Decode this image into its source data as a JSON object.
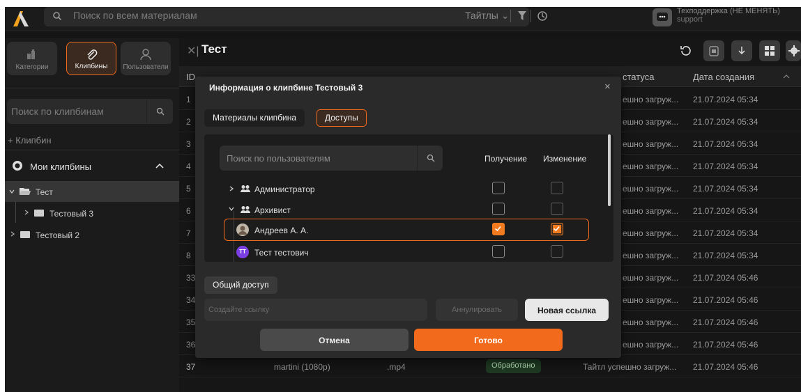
{
  "topbar": {
    "search_placeholder": "Поиск по всем материалам",
    "type_filter": "Тайтлы ⌄",
    "user_name": "Техподдержка (НЕ МЕНЯТЬ)",
    "user_role": "support"
  },
  "sidebar": {
    "tabs": [
      {
        "label": "Категории"
      },
      {
        "label": "Клипбины"
      },
      {
        "label": "Пользователи"
      }
    ],
    "search_placeholder": "Поиск по клипбинам",
    "add_label": "+ Клипбин",
    "my_clipbins": "Мои клипбины",
    "tree": [
      {
        "label": "Тест"
      },
      {
        "label": "Тестовый 3"
      },
      {
        "label": "Тестовый 2"
      }
    ]
  },
  "main": {
    "title": "Тест",
    "columns": {
      "id": "ID",
      "status": "статуса",
      "created": "Дата создания"
    },
    "rows": [
      {
        "id": "1",
        "status": "ешно загруж...",
        "date": "21.07.2024 05:34"
      },
      {
        "id": "2",
        "status": "ешно загруж...",
        "date": "21.07.2024 05:34"
      },
      {
        "id": "3",
        "status": "ешно загруж...",
        "date": "21.07.2024 05:34"
      },
      {
        "id": "4",
        "status": "ешно загруж...",
        "date": "21.07.2024 05:34"
      },
      {
        "id": "5",
        "status": "ешно загруж...",
        "date": "21.07.2024 05:34"
      },
      {
        "id": "6",
        "status": "ешно загруж...",
        "date": "21.07.2024 05:34"
      },
      {
        "id": "7",
        "status": "ешно загруж...",
        "date": "21.07.2024 05:34"
      },
      {
        "id": "8",
        "status": "ешно загруж...",
        "date": "21.07.2024 05:34"
      },
      {
        "id": "33",
        "status": "ешно загруж...",
        "date": "21.07.2024 05:46"
      },
      {
        "id": "34",
        "status": "ешно загруж...",
        "date": "21.07.2024 05:46"
      },
      {
        "id": "35",
        "status": "ешно загруж...",
        "date": "21.07.2024 05:46"
      },
      {
        "id": "36",
        "status": "ешно загруж...",
        "date": "21.07.2024 05:46"
      }
    ],
    "last_row": {
      "id": "37",
      "name": "martini (1080p)",
      "ext": ".mp4",
      "badge": "Обработано",
      "status": "Тайтл успешно загруж...",
      "date": "21.07.2024 05:46"
    }
  },
  "modal": {
    "title": "Информация о клипбине Тестовый 3",
    "tabs": {
      "materials": "Материалы клипбина",
      "access": "Доступы"
    },
    "user_search_placeholder": "Поиск по пользователям",
    "col_receive": "Получение",
    "col_change": "Изменение",
    "users": [
      {
        "label": "Администратор",
        "receive": false,
        "change": false
      },
      {
        "label": "Архивист",
        "receive": false,
        "change": false
      },
      {
        "label": "Андреев А. А.",
        "receive": true,
        "change": true
      },
      {
        "label": "Тест тестович",
        "receive": false,
        "change": false
      }
    ],
    "avatar_initials": "TT",
    "public_access": "Общий доступ",
    "link_placeholder": "Создайте ссылку",
    "revoke": "Аннулировать",
    "new_link": "Новая ссылка",
    "cancel": "Отмена",
    "done": "Готово"
  },
  "colors": {
    "accent": "#f26a1b",
    "bg": "#141414",
    "modal": "#2a2a2a"
  }
}
